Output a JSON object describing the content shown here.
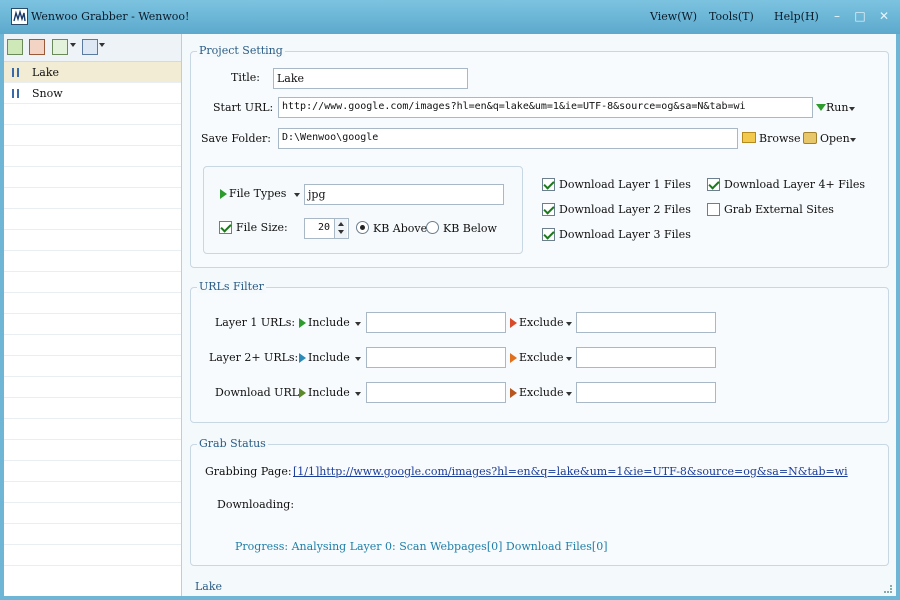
{
  "window": {
    "title": "Wenwoo Grabber - Wenwoo!",
    "menus": [
      "View(W)",
      "Tools(T)",
      "Help(H)"
    ],
    "controls": [
      "–",
      "□",
      "✕"
    ]
  },
  "sidebar": {
    "items": [
      {
        "label": "Lake",
        "selected": true
      },
      {
        "label": "Snow",
        "selected": false
      }
    ]
  },
  "project_setting": {
    "heading": "Project Setting",
    "title_label": "Title:",
    "title_value": "Lake",
    "start_url_label": "Start URL:",
    "start_url_value": "http://www.google.com/images?hl=en&q=lake&um=1&ie=UTF-8&source=og&sa=N&tab=wi",
    "run_label": "Run",
    "save_folder_label": "Save Folder:",
    "save_folder_value": "D:\\Wenwoo\\google",
    "browse_label": "Browse",
    "open_label": "Open",
    "file_types_label": "File Types",
    "file_types_value": "jpg",
    "file_size_label": "File Size:",
    "file_size_checked": true,
    "file_size_value": "20",
    "kb_above_label": "KB Above",
    "kb_below_label": "KB Below",
    "kb_mode": "above",
    "layers": [
      {
        "label": "Download Layer 1 Files",
        "checked": true
      },
      {
        "label": "Download Layer 2 Files",
        "checked": true
      },
      {
        "label": "Download Layer 3 Files",
        "checked": true
      },
      {
        "label": "Download Layer 4+ Files",
        "checked": true
      },
      {
        "label": "Grab External Sites",
        "checked": false
      }
    ]
  },
  "urls_filter": {
    "heading": "URLs Filter",
    "rows": [
      {
        "label": "Layer 1 URLs:",
        "include_label": "Include",
        "include_value": "",
        "exclude_label": "Exclude",
        "exclude_value": ""
      },
      {
        "label": "Layer 2+ URLs:",
        "include_label": "Include",
        "include_value": "",
        "exclude_label": "Exclude",
        "exclude_value": ""
      },
      {
        "label": "Download URL:",
        "include_label": "Include",
        "include_value": "",
        "exclude_label": "Exclude",
        "exclude_value": ""
      }
    ]
  },
  "grab_status": {
    "heading": "Grab Status",
    "grabbing_label": "Grabbing Page:",
    "grabbing_link": "[1/1]http://www.google.com/images?hl=en&q=lake&um=1&ie=UTF-8&source=og&sa=N&tab=wi",
    "downloading_label": "Downloading:",
    "progress": "Progress: Analysing Layer 0: Scan Webpages[0] Download Files[0]"
  },
  "status_bar": {
    "text": "Lake"
  },
  "colors": {
    "accent": "#2b5c86",
    "titlebar": "#6fb6d6",
    "link": "#1a3d9a"
  }
}
